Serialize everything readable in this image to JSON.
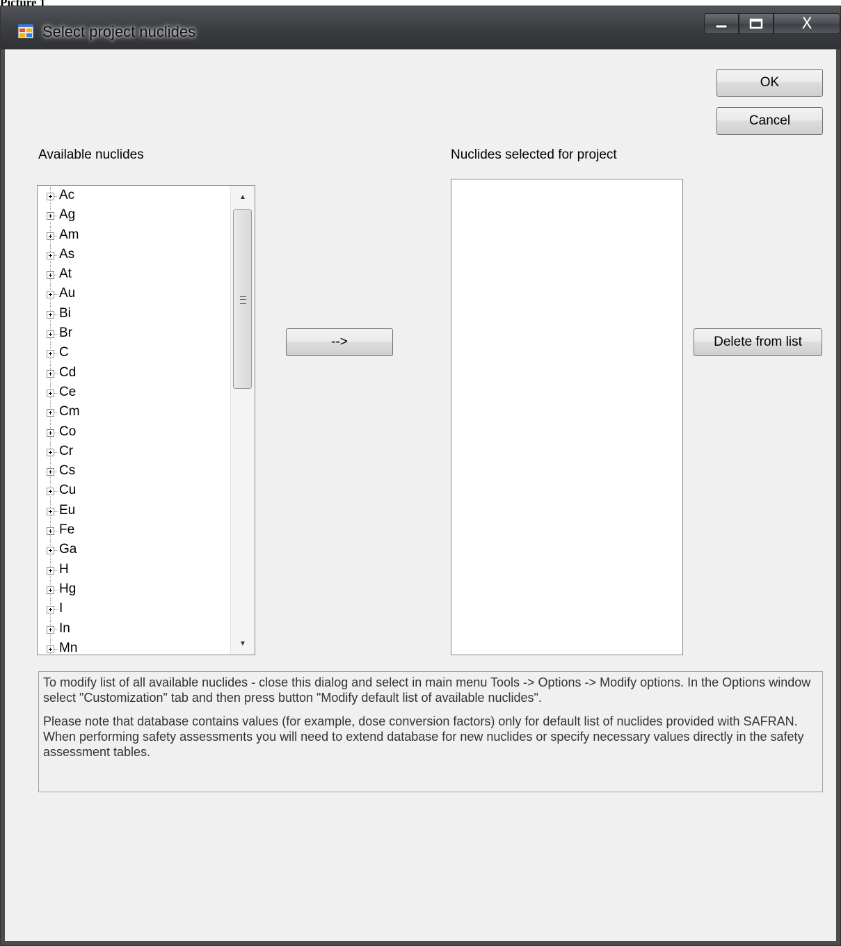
{
  "caption": "Picture 1",
  "window": {
    "title": "Select project nuclides",
    "close_glyph": "X"
  },
  "buttons": {
    "ok": "OK",
    "cancel": "Cancel",
    "add": "-->",
    "delete": "Delete from list"
  },
  "available": {
    "label": "Available nuclides",
    "items": [
      "Ac",
      "Ag",
      "Am",
      "As",
      "At",
      "Au",
      "Bi",
      "Br",
      "C",
      "Cd",
      "Ce",
      "Cm",
      "Co",
      "Cr",
      "Cs",
      "Cu",
      "Eu",
      "Fe",
      "Ga",
      "H",
      "Hg",
      "I",
      "In",
      "Mn"
    ]
  },
  "selected": {
    "label": "Nuclides selected for project",
    "items": []
  },
  "info": {
    "paragraph1": "To modify list of all available nuclides - close this dialog and select in  main menu Tools -> Options -> Modify options. In the Options window select \"Customization\" tab and then press button \"Modify default list of available nuclides\".",
    "paragraph2": "Please note that database contains values  (for example, dose conversion factors)  only for default list of  nuclides provided with SAFRAN.  When performing safety assessments you will need to extend database for new nuclides or specify necessary values directly in the safety assessment tables."
  },
  "icons": {
    "app": "app-window-icon",
    "minimize": "minimize-icon",
    "maximize": "maximize-icon",
    "close": "close-icon",
    "scroll_up": "scroll-up-arrow-icon",
    "scroll_down": "scroll-down-arrow-icon",
    "expander": "expand-plus-icon"
  }
}
